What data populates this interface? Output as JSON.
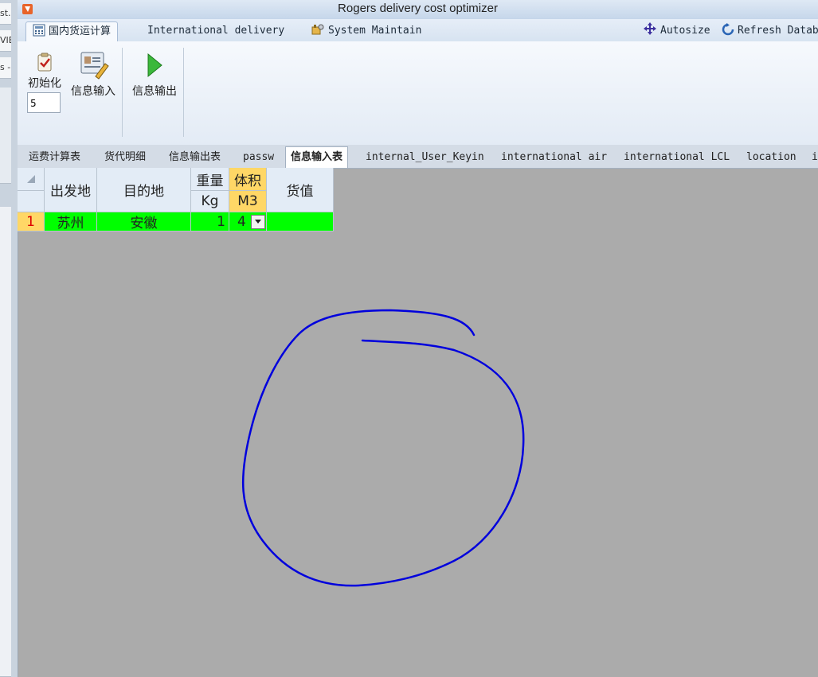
{
  "window": {
    "title": "Rogers delivery cost optimizer"
  },
  "background_window": {
    "snippets": [
      "st.a",
      "VIE",
      "s -"
    ]
  },
  "ribbon_tabs": [
    {
      "label": "国内货运计算",
      "icon": "calculator-icon",
      "active": true
    },
    {
      "label": "International delivery",
      "active": false
    },
    {
      "label": "System Maintain",
      "icon": "tools-icon",
      "active": false
    }
  ],
  "ribbon_right": {
    "autosize": "Autosize",
    "refresh": "Refresh Datab"
  },
  "ribbon": {
    "init_label": "初始化",
    "init_value": "5",
    "info_input": "信息输入",
    "info_output": "信息输出"
  },
  "sheet_tabs": [
    "运费计算表",
    "货代明细",
    "信息输出表",
    "passw",
    "信息输入表",
    "internal_User_Keyin",
    "international air",
    "international LCL",
    "location",
    "i"
  ],
  "active_sheet": "信息输入表",
  "grid": {
    "headers": {
      "origin": "出发地",
      "destination": "目的地",
      "weight": "重量",
      "weight_unit": "Kg",
      "volume": "体积",
      "volume_unit": "M3",
      "value": "货值"
    },
    "rows": [
      {
        "num": "1",
        "origin": "苏州",
        "destination": "安徽",
        "weight": "1",
        "volume": "4",
        "value": ""
      }
    ]
  },
  "colors": {
    "annotation_stroke": "#0000dd",
    "row_highlight": "#00ff00",
    "header_yellow": "#ffd766"
  }
}
